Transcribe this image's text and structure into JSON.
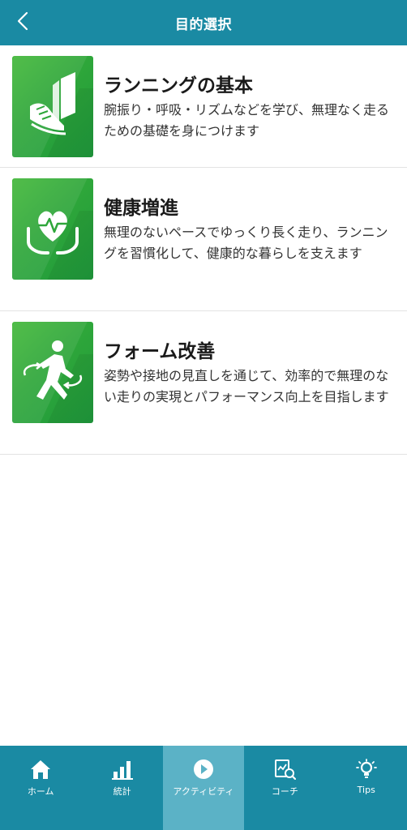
{
  "header": {
    "title": "目的選択",
    "back_icon": "chevron-left-icon"
  },
  "goals": [
    {
      "title": "ランニングの基本",
      "description": "腕振り・呼吸・リズムなどを学び、無理なく走るための基礎を身につけます",
      "icon": "shoe-and-book-icon"
    },
    {
      "title": "健康増進",
      "description": "無理のないペースでゆっくり長く走り、ランニングを習慣化して、健康的な暮らしを支えます",
      "icon": "heart-in-hands-icon"
    },
    {
      "title": "フォーム改善",
      "description": "姿勢や接地の見直しを通じて、効率的で無理のない走りの実現とパフォーマンス向上を目指します",
      "icon": "runner-icon"
    }
  ],
  "tabbar": {
    "tabs": [
      {
        "label": "ホーム",
        "icon": "home-icon"
      },
      {
        "label": "統計",
        "icon": "bar-chart-icon"
      },
      {
        "label": "アクティビティ",
        "icon": "play-circle-icon",
        "active": true
      },
      {
        "label": "コーチ",
        "icon": "coach-report-icon"
      },
      {
        "label": "Tips",
        "icon": "lightbulb-icon"
      }
    ]
  },
  "colors": {
    "primary": "#1a8aa3",
    "active_tab": "#5bb2c6",
    "thumb_green": "#2ea63a"
  }
}
